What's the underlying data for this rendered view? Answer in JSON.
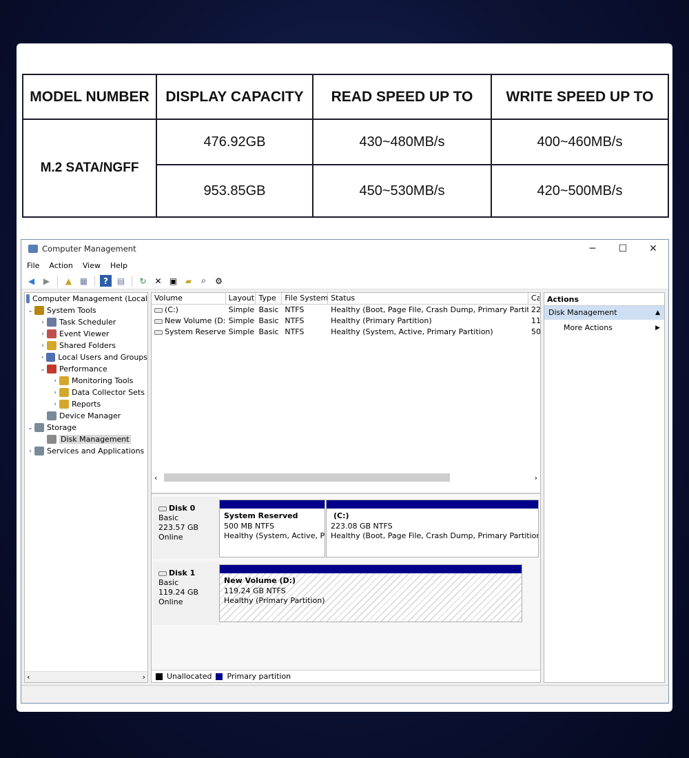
{
  "spec_table": {
    "headers": [
      "MODEL NUMBER",
      "DISPLAY CAPACITY",
      "READ SPEED UP TO",
      "WRITE SPEED UP TO"
    ],
    "model": "M.2 SATA/NGFF",
    "rows": [
      {
        "capacity": "476.92GB",
        "read": "430~480MB/s",
        "write": "400~460MB/s"
      },
      {
        "capacity": "953.85GB",
        "read": "450~530MB/s",
        "write": "420~500MB/s"
      }
    ]
  },
  "window": {
    "title": "Computer Management",
    "controls": {
      "minimize": "─",
      "maximize": "☐",
      "close": "✕"
    },
    "menu": [
      "File",
      "Action",
      "View",
      "Help"
    ]
  },
  "tree": {
    "root": "Computer Management (Local",
    "items": [
      {
        "label": "System Tools",
        "arrow": "⌄",
        "indent": 1,
        "icon_color": "#b8860b",
        "icon": "tools-icon"
      },
      {
        "label": "Task Scheduler",
        "arrow": "›",
        "indent": 2,
        "icon_color": "#6a7aa0",
        "icon": "clock-icon"
      },
      {
        "label": "Event Viewer",
        "arrow": "›",
        "indent": 2,
        "icon_color": "#c0504d",
        "icon": "event-viewer-icon"
      },
      {
        "label": "Shared Folders",
        "arrow": "›",
        "indent": 2,
        "icon_color": "#d4a72c",
        "icon": "shared-folder-icon"
      },
      {
        "label": "Local Users and Groups",
        "arrow": "›",
        "indent": 2,
        "icon_color": "#4f6fb0",
        "icon": "users-icon"
      },
      {
        "label": "Performance",
        "arrow": "⌄",
        "indent": 2,
        "icon_color": "#c0392b",
        "icon": "performance-icon"
      },
      {
        "label": "Monitoring Tools",
        "arrow": "›",
        "indent": 3,
        "icon_color": "#d4a72c",
        "icon": "monitoring-icon"
      },
      {
        "label": "Data Collector Sets",
        "arrow": "›",
        "indent": 3,
        "icon_color": "#d4a72c",
        "icon": "data-collector-icon"
      },
      {
        "label": "Reports",
        "arrow": "›",
        "indent": 3,
        "icon_color": "#d4a72c",
        "icon": "reports-icon"
      },
      {
        "label": "Device Manager",
        "arrow": "",
        "indent": 2,
        "icon_color": "#7a8a99",
        "icon": "device-manager-icon"
      },
      {
        "label": "Storage",
        "arrow": "⌄",
        "indent": 1,
        "icon_color": "#7a8a99",
        "icon": "storage-icon"
      },
      {
        "label": "Disk Management",
        "arrow": "",
        "indent": 2,
        "icon_color": "#8a8a8a",
        "icon": "disk-icon",
        "selected": true
      },
      {
        "label": "Services and Applications",
        "arrow": "›",
        "indent": 1,
        "icon_color": "#7a8a99",
        "icon": "services-icon"
      }
    ]
  },
  "volumes": {
    "columns": [
      "Volume",
      "Layout",
      "Type",
      "File System",
      "Status",
      "Ca"
    ],
    "rows": [
      {
        "volume": "(C:)",
        "layout": "Simple",
        "type": "Basic",
        "fs": "NTFS",
        "status": "Healthy (Boot, Page File, Crash Dump, Primary Partition)",
        "cap": "22"
      },
      {
        "volume": "New Volume (D:)",
        "layout": "Simple",
        "type": "Basic",
        "fs": "NTFS",
        "status": "Healthy (Primary Partition)",
        "cap": "11"
      },
      {
        "volume": "System Reserved",
        "layout": "Simple",
        "type": "Basic",
        "fs": "NTFS",
        "status": "Healthy (System, Active, Primary Partition)",
        "cap": "50"
      }
    ]
  },
  "disks": [
    {
      "name": "Disk 0",
      "type": "Basic",
      "size": "223.57 GB",
      "state": "Online",
      "partitions": [
        {
          "name": "System Reserved",
          "size": "500 MB NTFS",
          "status": "Healthy (System, Active, Pri"
        },
        {
          "name": "(C:)",
          "size": "223.08 GB NTFS",
          "status": "Healthy (Boot, Page File, Crash Dump, Primary Partition)"
        }
      ]
    },
    {
      "name": "Disk 1",
      "type": "Basic",
      "size": "119.24 GB",
      "state": "Online",
      "partitions": [
        {
          "name": "New Volume  (D:)",
          "size": "119.24 GB NTFS",
          "status": "Healthy (Primary Partition)"
        }
      ]
    }
  ],
  "legend": [
    {
      "label": "Unallocated",
      "color": "#000000"
    },
    {
      "label": "Primary partition",
      "color": "#00008b"
    }
  ],
  "actions": {
    "header": "Actions",
    "section": "Disk Management",
    "items": [
      "More Actions"
    ]
  },
  "colors": {
    "partition_bar": "#00008b",
    "selected_section": "#cfdff3"
  }
}
